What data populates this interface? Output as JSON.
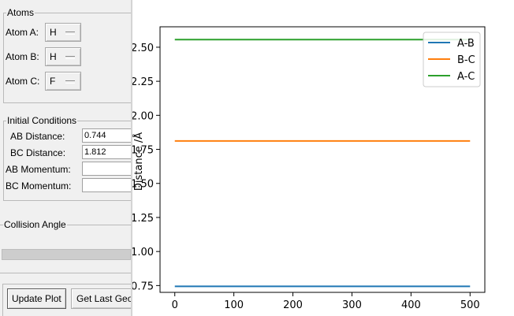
{
  "panel": {
    "atoms": {
      "title": "Atoms",
      "rows": [
        {
          "label": "Atom A:",
          "value": "H"
        },
        {
          "label": "Atom B:",
          "value": "H"
        },
        {
          "label": "Atom C:",
          "value": "F"
        }
      ]
    },
    "initial_conditions": {
      "title": "Initial Conditions",
      "ab_distance": {
        "label": "AB Distance:",
        "value": "0.744"
      },
      "bc_distance": {
        "label": "BC Distance:",
        "value": "1.812"
      },
      "ab_momentum": {
        "label": "AB Momentum:",
        "value": ""
      },
      "bc_momentum": {
        "label": "BC Momentum:",
        "value": ""
      }
    },
    "collision_angle": {
      "title": "Collision Angle"
    },
    "buttons": {
      "update_plot": "Update Plot",
      "get_last_geometry": "Get Last Geometry"
    }
  },
  "chart_data": {
    "type": "line",
    "title": "",
    "xlabel": "",
    "ylabel": "Distance /Å",
    "xlim": [
      -25,
      525
    ],
    "ylim": [
      0.7,
      2.65
    ],
    "xticks": [
      0,
      100,
      200,
      300,
      400,
      500
    ],
    "yticks": [
      0.75,
      1.0,
      1.25,
      1.5,
      1.75,
      2.0,
      2.25,
      2.5
    ],
    "xtick_labels": [
      "0",
      "100",
      "200",
      "300",
      "400",
      "500"
    ],
    "ytick_labels": [
      "0.75",
      "1.00",
      "1.25",
      "1.50",
      "1.75",
      "2.00",
      "2.25",
      "2.50"
    ],
    "grid": false,
    "legend": "top-right",
    "series": [
      {
        "name": "A-B",
        "color": "#1f77b4",
        "x": [
          0,
          500
        ],
        "y": [
          0.744,
          0.744
        ]
      },
      {
        "name": "B-C",
        "color": "#ff7f0e",
        "x": [
          0,
          500
        ],
        "y": [
          1.812,
          1.812
        ]
      },
      {
        "name": "A-C",
        "color": "#2ca02c",
        "x": [
          0,
          500
        ],
        "y": [
          2.556,
          2.556
        ]
      }
    ]
  }
}
